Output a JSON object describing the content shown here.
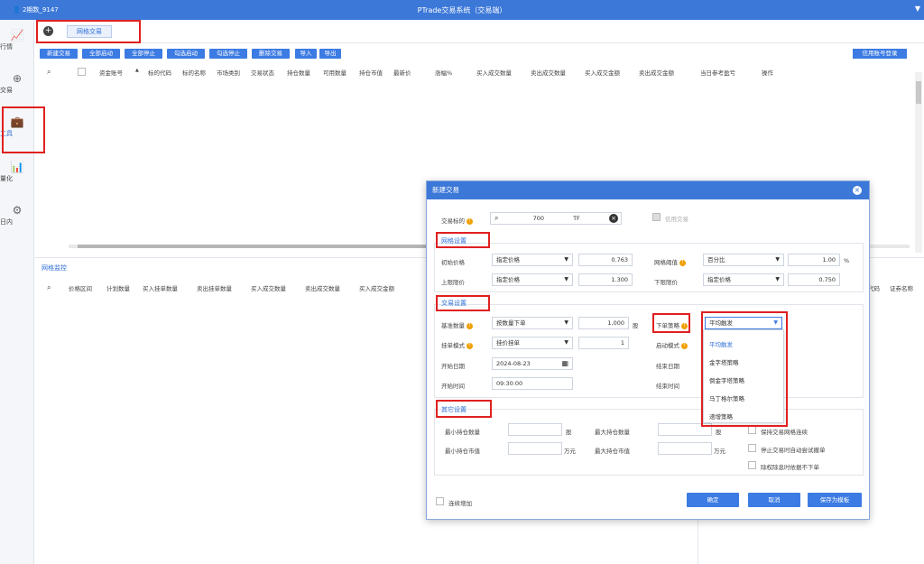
{
  "topbar": {
    "user": "2期数_9147",
    "title": "PTrade交易系统（交易端）",
    "menu_icon": "▼"
  },
  "nav": [
    {
      "label": "行情",
      "icon": "chart-icon",
      "glyph": "📈"
    },
    {
      "label": "交易",
      "icon": "trade-icon",
      "glyph": "⊕"
    },
    {
      "label": "工具",
      "icon": "toolbox-icon",
      "glyph": "💼"
    },
    {
      "label": "量化",
      "icon": "quant-icon",
      "glyph": "📊"
    },
    {
      "label": "日内",
      "icon": "intraday-icon",
      "glyph": "⚙"
    }
  ],
  "tabs": {
    "add_glyph": "+",
    "active": "网格交易"
  },
  "toolbar": {
    "buttons": [
      "新建交易",
      "全部启动",
      "全部停止",
      "勾选启动",
      "勾选停止",
      "删除交易",
      "导入",
      "导出"
    ],
    "credit_login": "信用账号登录"
  },
  "table_headers": [
    "资金账号",
    "标的代码",
    "标的名称",
    "市场类别",
    "交易状态",
    "持仓数量",
    "可用数量",
    "持仓市值",
    "最新价",
    "涨幅%",
    "买入成交数量",
    "卖出成交数量",
    "买入成交金额",
    "卖出成交金额",
    "当日参考盈亏",
    "操作"
  ],
  "sort_marker": "▲",
  "bottom": {
    "title": "网格监控",
    "headers": [
      "价格区间",
      "计划数量",
      "买入挂单数量",
      "卖出挂单数量",
      "买入成交数量",
      "卖出成交数量",
      "买入成交金额"
    ],
    "right_headers": [
      "代码",
      "证券名称"
    ]
  },
  "dialog": {
    "title": "新建交易",
    "close": "×",
    "target_label": "交易标的",
    "target_value": "700",
    "target_suffix": "TF",
    "credit_check": "信用交易",
    "grid_section": "网格设置",
    "initial_price_label": "初始价格",
    "initial_price_mode": "指定价格",
    "initial_price_value": "0.763",
    "grid_threshold_label": "网格阈值",
    "grid_threshold_mode": "百分比",
    "grid_threshold_value": "1.00",
    "grid_threshold_unit": "%",
    "upper_label": "上限限价",
    "upper_mode": "指定价格",
    "upper_value": "1.300",
    "lower_label": "下限限价",
    "lower_mode": "指定价格",
    "lower_value": "0.750",
    "trade_section": "交易设置",
    "base_qty_label": "基准数量",
    "base_qty_mode": "按数量下单",
    "base_qty_value": "1,000",
    "base_qty_unit": "股",
    "order_strategy_label": "下单策略",
    "order_strategy_value": "平均触发",
    "hang_mode_label": "挂单模式",
    "hang_mode_value": "挂价挂单",
    "hang_mode_qty": "1",
    "start_mode_label": "启动模式",
    "start_date_label": "开始日期",
    "start_date_value": "2024-08-23",
    "end_date_label": "结束日期",
    "start_time_label": "开始时间",
    "start_time_value": "09:30:00",
    "end_time_label": "结束时间",
    "strategy_options": [
      "平均触发",
      "金字塔策略",
      "倒金字塔策略",
      "马丁格尔策略",
      "递增策略"
    ],
    "other_section": "其它设置",
    "min_pos_qty": "最小持仓数量",
    "max_pos_qty": "最大持仓数量",
    "min_pos_value": "最小持仓市值",
    "max_pos_value": "最大持仓市值",
    "unit_shares": "股",
    "unit_wan": "万元",
    "opt1": "保持交易网格连续",
    "opt2": "停止交易时自动尝试撤单",
    "opt3": "除权除息时依据不下单",
    "continuous_label": "连续增加",
    "ok": "确定",
    "cancel": "取消",
    "save_template": "保存为模板"
  }
}
